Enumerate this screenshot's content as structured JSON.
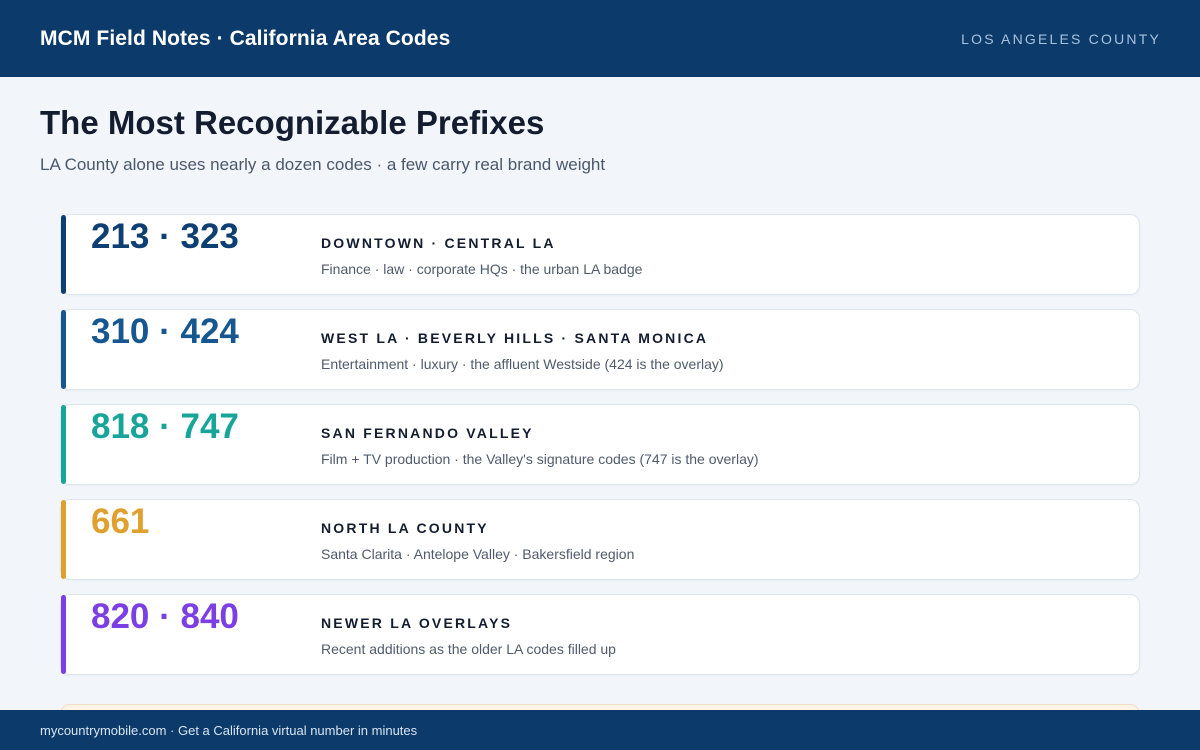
{
  "header": {
    "title": "MCM Field Notes · California Area Codes",
    "region": "LOS ANGELES COUNTY"
  },
  "main": {
    "title": "The Most Recognizable Prefixes",
    "subtitle": "LA County alone uses nearly a dozen codes · a few carry real brand weight"
  },
  "cards": [
    {
      "codes": "213 · 323",
      "area": "DOWNTOWN · CENTRAL LA",
      "description": "Finance · law · corporate HQs · the urban LA badge",
      "color": "#0e3f73"
    },
    {
      "codes": "310 · 424",
      "area": "WEST LA · BEVERLY HILLS · SANTA MONICA",
      "description": "Entertainment · luxury · the affluent Westside (424 is the overlay)",
      "color": "#16578f"
    },
    {
      "codes": "818 · 747",
      "area": "SAN FERNANDO VALLEY",
      "description": "Film + TV production · the Valley's signature codes (747 is the overlay)",
      "color": "#17a59a"
    },
    {
      "codes": "661",
      "area": "NORTH LA COUNTY",
      "description": "Santa Clarita · Antelope Valley · Bakersfield region",
      "color": "#e0a030"
    },
    {
      "codes": "820 · 840",
      "area": "NEWER LA OVERLAYS",
      "description": "Recent additions as the older LA codes filled up",
      "color": "#7b3fe4"
    }
  ],
  "footer": {
    "text": "mycountrymobile.com · Get a California virtual number in minutes"
  }
}
